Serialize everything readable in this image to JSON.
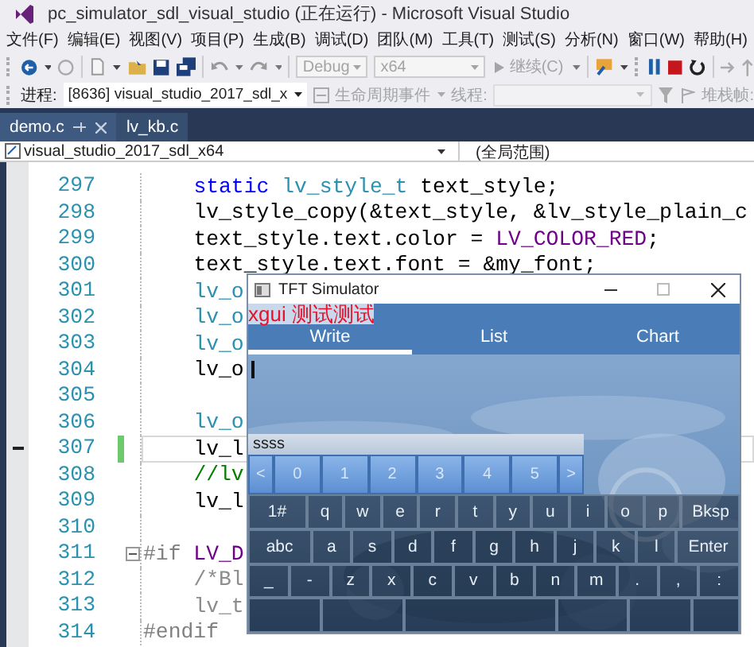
{
  "window": {
    "title": "pc_simulator_sdl_visual_studio (正在运行) - Microsoft Visual Studio"
  },
  "menu": [
    "文件(F)",
    "编辑(E)",
    "视图(V)",
    "项目(P)",
    "生成(B)",
    "调试(D)",
    "团队(M)",
    "工具(T)",
    "测试(S)",
    "分析(N)",
    "窗口(W)",
    "帮助(H)"
  ],
  "toolbar": {
    "configuration": {
      "value": "Debug",
      "disabled": true
    },
    "platform": {
      "value": "x64",
      "disabled": true
    },
    "continue": {
      "label": "继续(C)",
      "disabled": true
    }
  },
  "debug_bar": {
    "process_label": "进程:",
    "process": "[8636] visual_studio_2017_sdl_x",
    "lifecycle": "生命周期事件",
    "thread_label": "线程:",
    "stack_label": "堆栈帧:",
    "disabled": true
  },
  "tabs": [
    {
      "label": "demo.c",
      "selected": true
    },
    {
      "label": "lv_kb.c",
      "selected": false
    }
  ],
  "nav": {
    "project": "visual_studio_2017_sdl_x64",
    "scope": "(全局范围)"
  },
  "editor": {
    "lines": [
      {
        "number": "297",
        "indented": true,
        "current": false,
        "changed": false,
        "marked": false,
        "foldable": false,
        "tokens": [
          {
            "kind": "keyword",
            "text": "static"
          },
          {
            "kind": "type",
            "text": " lv_style_t"
          },
          {
            "kind": "plain",
            "text": " text_style;"
          }
        ]
      },
      {
        "number": "298",
        "indented": true,
        "current": false,
        "changed": false,
        "marked": false,
        "foldable": false,
        "tokens": [
          {
            "kind": "plain",
            "text": "lv_style_copy(&text_style, &lv_style_plain_c"
          }
        ]
      },
      {
        "number": "299",
        "indented": true,
        "current": false,
        "changed": false,
        "marked": false,
        "foldable": false,
        "tokens": [
          {
            "kind": "plain",
            "text": "text_style.text.color = "
          },
          {
            "kind": "macro",
            "text": "LV_COLOR_RED"
          },
          {
            "kind": "plain",
            "text": ";"
          }
        ]
      },
      {
        "number": "300",
        "indented": true,
        "current": false,
        "changed": false,
        "marked": false,
        "foldable": false,
        "tokens": [
          {
            "kind": "plain",
            "text": "text_style.text.font = &my_font;"
          }
        ]
      },
      {
        "number": "301",
        "indented": true,
        "current": false,
        "changed": false,
        "marked": false,
        "foldable": false,
        "tokens": [
          {
            "kind": "type",
            "text": "lv_o"
          }
        ]
      },
      {
        "number": "302",
        "indented": true,
        "current": false,
        "changed": false,
        "marked": false,
        "foldable": false,
        "tokens": [
          {
            "kind": "type",
            "text": "lv_o"
          }
        ]
      },
      {
        "number": "303",
        "indented": true,
        "current": false,
        "changed": false,
        "marked": false,
        "foldable": false,
        "tokens": [
          {
            "kind": "type",
            "text": "lv_o"
          }
        ]
      },
      {
        "number": "304",
        "indented": true,
        "current": false,
        "changed": false,
        "marked": false,
        "foldable": false,
        "tokens": [
          {
            "kind": "plain",
            "text": "lv_o"
          }
        ]
      },
      {
        "number": "305",
        "current": false,
        "changed": false,
        "marked": false,
        "foldable": false
      },
      {
        "number": "306",
        "indented": true,
        "current": false,
        "changed": false,
        "marked": false,
        "foldable": false,
        "tokens": [
          {
            "kind": "type",
            "text": "lv_o"
          }
        ]
      },
      {
        "number": "307",
        "indented": true,
        "current": true,
        "changed": true,
        "marked": true,
        "foldable": false,
        "tokens": [
          {
            "kind": "plain",
            "text": "lv_l"
          }
        ]
      },
      {
        "number": "308",
        "indented": true,
        "current": false,
        "changed": false,
        "marked": false,
        "foldable": false,
        "tokens": [
          {
            "kind": "comment",
            "text": "//lv"
          }
        ]
      },
      {
        "number": "309",
        "indented": true,
        "current": false,
        "changed": false,
        "marked": false,
        "foldable": false,
        "tokens": [
          {
            "kind": "plain",
            "text": "lv_l"
          }
        ]
      },
      {
        "number": "310",
        "current": false,
        "changed": false,
        "marked": false,
        "foldable": false
      },
      {
        "number": "311",
        "indented": false,
        "current": false,
        "changed": false,
        "marked": false,
        "foldable": true,
        "tokens": [
          {
            "kind": "directive",
            "text": "#if"
          },
          {
            "kind": "macro",
            "text": " LV_D"
          }
        ]
      },
      {
        "number": "312",
        "indented": true,
        "current": false,
        "changed": false,
        "marked": false,
        "foldable": false,
        "tokens": [
          {
            "kind": "inactive",
            "text": "/*Bl"
          }
        ]
      },
      {
        "number": "313",
        "indented": true,
        "current": false,
        "changed": false,
        "marked": false,
        "foldable": false,
        "tokens": [
          {
            "kind": "inactive",
            "text": "lv_t"
          }
        ]
      },
      {
        "number": "314",
        "indented": false,
        "current": false,
        "changed": false,
        "marked": false,
        "foldable": false,
        "tokens": [
          {
            "kind": "directive",
            "text": "#endif"
          }
        ]
      }
    ]
  },
  "simulator": {
    "title": "TFT Simulator",
    "overlay": "xgui 测试测试",
    "tabs": [
      {
        "label": "Write",
        "selected": true
      },
      {
        "label": "List",
        "selected": false
      },
      {
        "label": "Chart",
        "selected": false
      }
    ],
    "input": "ssss",
    "candidates": [
      "<",
      "0",
      "1",
      "2",
      "3",
      "4",
      "5",
      ">"
    ],
    "keyboard": [
      {
        "wide_ends": true,
        "keys": [
          "1#",
          "q",
          "w",
          "e",
          "r",
          "t",
          "y",
          "u",
          "i",
          "o",
          "p",
          "Bksp"
        ]
      },
      {
        "wide_ends": true,
        "keys": [
          "abc",
          "a",
          "s",
          "d",
          "f",
          "g",
          "h",
          "j",
          "k",
          "l",
          "Enter"
        ]
      },
      {
        "wide_ends": false,
        "keys": [
          "_",
          "-",
          "z",
          "x",
          "c",
          "v",
          "b",
          "n",
          "m",
          ".",
          ",",
          ":"
        ]
      }
    ]
  }
}
